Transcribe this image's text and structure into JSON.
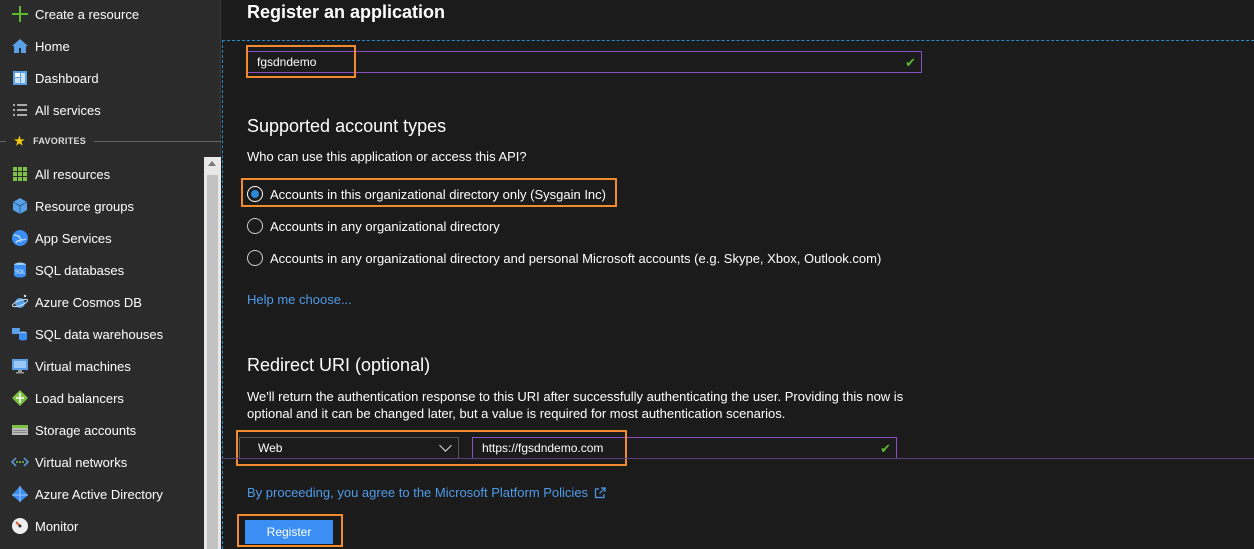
{
  "sidebar": {
    "top_items": [
      {
        "label": "Create a resource",
        "icon": "plus-icon"
      },
      {
        "label": "Home",
        "icon": "home-icon"
      },
      {
        "label": "Dashboard",
        "icon": "dashboard-icon"
      },
      {
        "label": "All services",
        "icon": "list-icon"
      }
    ],
    "favorites_label": "FAVORITES",
    "favorites": [
      {
        "label": "All resources",
        "icon": "grid-icon"
      },
      {
        "label": "Resource groups",
        "icon": "cube-icon"
      },
      {
        "label": "App Services",
        "icon": "globe-icon"
      },
      {
        "label": "SQL databases",
        "icon": "database-icon"
      },
      {
        "label": "Azure Cosmos DB",
        "icon": "planet-icon"
      },
      {
        "label": "SQL data warehouses",
        "icon": "warehouse-icon"
      },
      {
        "label": "Virtual machines",
        "icon": "monitor-icon"
      },
      {
        "label": "Load balancers",
        "icon": "diamond-icon"
      },
      {
        "label": "Storage accounts",
        "icon": "storage-icon"
      },
      {
        "label": "Virtual networks",
        "icon": "network-icon"
      },
      {
        "label": "Azure Active Directory",
        "icon": "pyramid-icon"
      },
      {
        "label": "Monitor",
        "icon": "gauge-icon"
      }
    ]
  },
  "main": {
    "title": "Register an application",
    "name_value": "fgsdndemo",
    "account_types": {
      "title": "Supported account types",
      "question": "Who can use this application or access this API?",
      "options": [
        {
          "label": "Accounts in this organizational directory only (Sysgain Inc)",
          "selected": true
        },
        {
          "label": "Accounts in any organizational directory",
          "selected": false
        },
        {
          "label": "Accounts in any organizational directory and personal Microsoft accounts (e.g. Skype, Xbox, Outlook.com)",
          "selected": false
        }
      ],
      "help_link": "Help me choose..."
    },
    "redirect": {
      "title": "Redirect URI (optional)",
      "desc_line1": "We'll return the authentication response to this URI after successfully authenticating the user. Providing this now is",
      "desc_line2": "optional and it can be changed later, but a value is required for most authentication scenarios.",
      "platform_value": "Web",
      "uri_value": "https://fgsdndemo.com"
    },
    "policy_text": "By proceeding, you agree to the Microsoft Platform Policies",
    "register_label": "Register"
  },
  "colors": {
    "accent": "#3a8ef4",
    "highlight": "#f28a2e",
    "link": "#4f9be8",
    "valid": "#5fb832"
  }
}
